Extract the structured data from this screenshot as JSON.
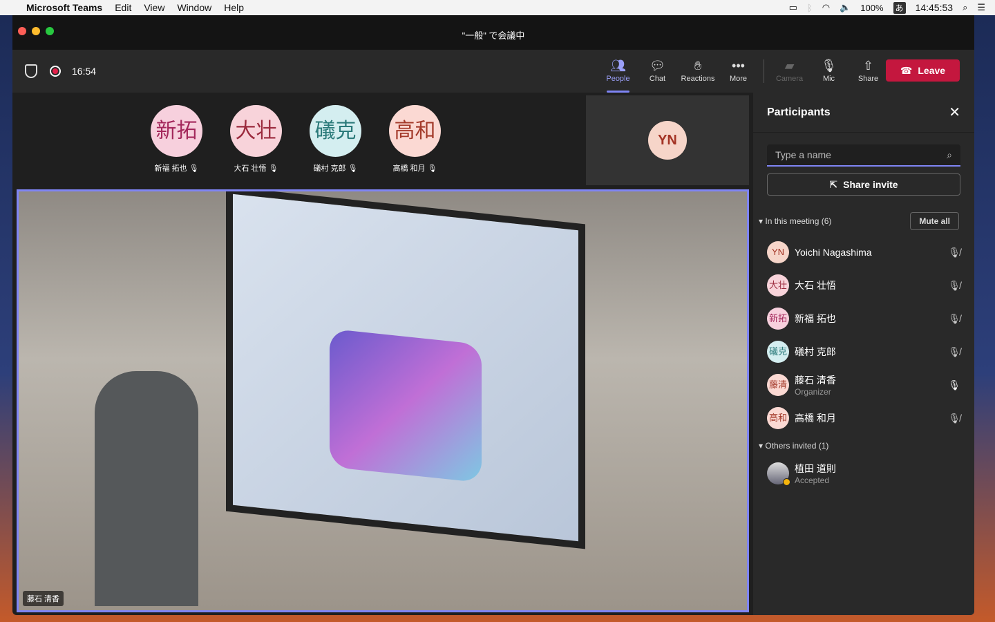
{
  "menubar": {
    "app": "Microsoft Teams",
    "items": [
      "Edit",
      "View",
      "Window",
      "Help"
    ],
    "battery": "100%",
    "ime": "あ",
    "time": "14:45:53"
  },
  "window": {
    "title": "\"一般\" で会議中"
  },
  "toolbar": {
    "timer": "16:54",
    "buttons": [
      {
        "label": "People",
        "icon": "people-icon"
      },
      {
        "label": "Chat",
        "icon": "chat-icon"
      },
      {
        "label": "Reactions",
        "icon": "reactions-icon"
      },
      {
        "label": "More",
        "icon": "more-icon"
      }
    ],
    "camera": "Camera",
    "mic": "Mic",
    "share": "Share",
    "leave": "Leave",
    "accent": "#7f85f5",
    "leave_color": "#c4173e"
  },
  "stage": {
    "avatars": [
      {
        "initials": "新拓",
        "name": "新福 拓也",
        "bg": "#f7d0dd",
        "fg": "#a3275b"
      },
      {
        "initials": "大壮",
        "name": "大石 壮悟",
        "bg": "#f8d3da",
        "fg": "#9b2a3d"
      },
      {
        "initials": "礒克",
        "name": "礒村 克郎",
        "bg": "#d4eef0",
        "fg": "#2b7a7a"
      },
      {
        "initials": "高和",
        "name": "高橋 和月",
        "bg": "#fbd9d3",
        "fg": "#a33a2a"
      }
    ],
    "self_initials": "YN",
    "video_label": "藤石 清香"
  },
  "panel": {
    "title": "Participants",
    "search_placeholder": "Type a name",
    "share_invite": "Share invite",
    "in_meeting": "In this meeting (6)",
    "mute_all": "Mute all",
    "others": "Others invited (1)",
    "participants": [
      {
        "initials": "YN",
        "name": "Yoichi Nagashima",
        "sub": "",
        "bg": "#f6d5c9",
        "fg": "#a33324",
        "mic": "muted"
      },
      {
        "initials": "大壮",
        "name": "大石 壮悟",
        "sub": "",
        "bg": "#f8d3da",
        "fg": "#9b2a3d",
        "mic": "muted"
      },
      {
        "initials": "新拓",
        "name": "新福 拓也",
        "sub": "",
        "bg": "#f7d0dd",
        "fg": "#a3275b",
        "mic": "muted"
      },
      {
        "initials": "礒克",
        "name": "礒村 克郎",
        "sub": "",
        "bg": "#d4eef0",
        "fg": "#2b7a7a",
        "mic": "muted"
      },
      {
        "initials": "藤清",
        "name": "藤石 清香",
        "sub": "Organizer",
        "bg": "#fbd9d3",
        "fg": "#a33a2a",
        "mic": "on"
      },
      {
        "initials": "高和",
        "name": "高橋 和月",
        "sub": "",
        "bg": "#fbd9d3",
        "fg": "#a33a2a",
        "mic": "muted"
      }
    ],
    "invited": [
      {
        "name": "植田 道則",
        "sub": "Accepted"
      }
    ]
  }
}
